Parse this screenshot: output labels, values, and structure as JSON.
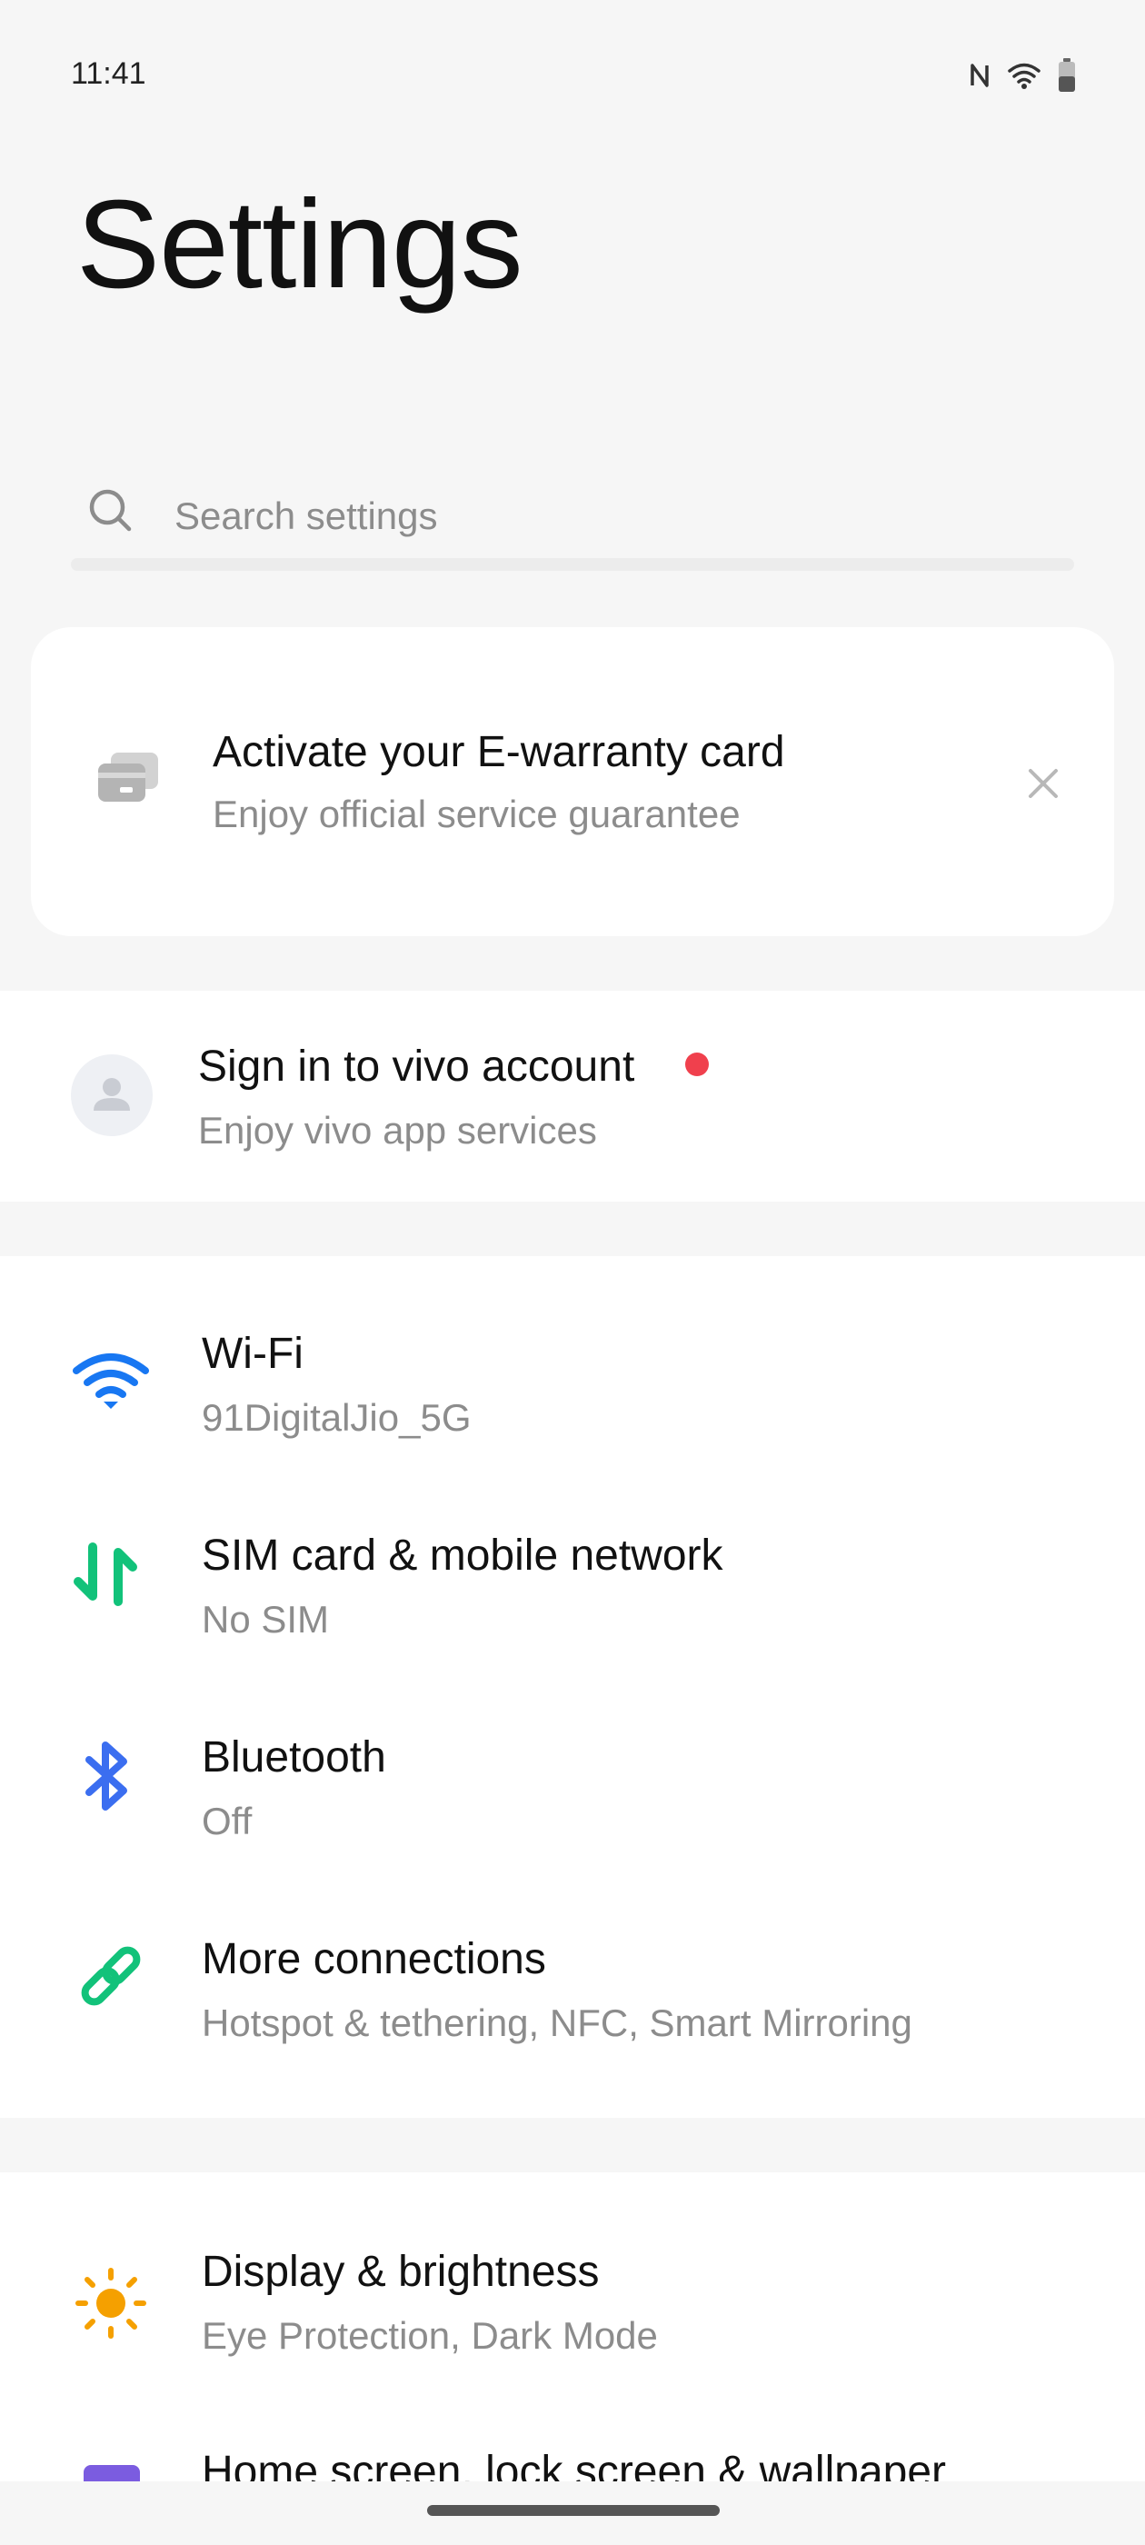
{
  "status_bar": {
    "time": "11:41",
    "icons": [
      "nfc-icon",
      "wifi-icon",
      "battery-icon"
    ]
  },
  "page": {
    "title": "Settings"
  },
  "search": {
    "placeholder": "Search settings",
    "icon": "search-icon"
  },
  "warranty_card": {
    "title": "Activate your E-warranty card",
    "subtitle": "Enjoy official service guarantee",
    "icon": "card-icon"
  },
  "account": {
    "title": "Sign in to vivo account",
    "subtitle": "Enjoy vivo app services",
    "icon": "avatar-icon",
    "notification_color": "#f0404d"
  },
  "connections": [
    {
      "title": "Wi-Fi",
      "subtitle": "91DigitalJio_5G",
      "icon": "wifi-icon",
      "color": "#1877f2"
    },
    {
      "title": "SIM card & mobile network",
      "subtitle": "No SIM",
      "icon": "mobile-data-icon",
      "color": "#12c27a"
    },
    {
      "title": "Bluetooth",
      "subtitle": "Off",
      "icon": "bluetooth-icon",
      "color": "#3b6ef0"
    },
    {
      "title": "More connections",
      "subtitle": "Hotspot & tethering, NFC, Smart Mirroring",
      "icon": "link-icon",
      "color": "#12c27a"
    }
  ],
  "display": [
    {
      "title": "Display & brightness",
      "subtitle": "Eye Protection, Dark Mode",
      "icon": "sun-icon",
      "color": "#f5a000"
    },
    {
      "title": "Home screen, lock screen & wallpaper",
      "subtitle": "",
      "icon": "wallpaper-icon",
      "color": "#7b5ce0"
    }
  ]
}
